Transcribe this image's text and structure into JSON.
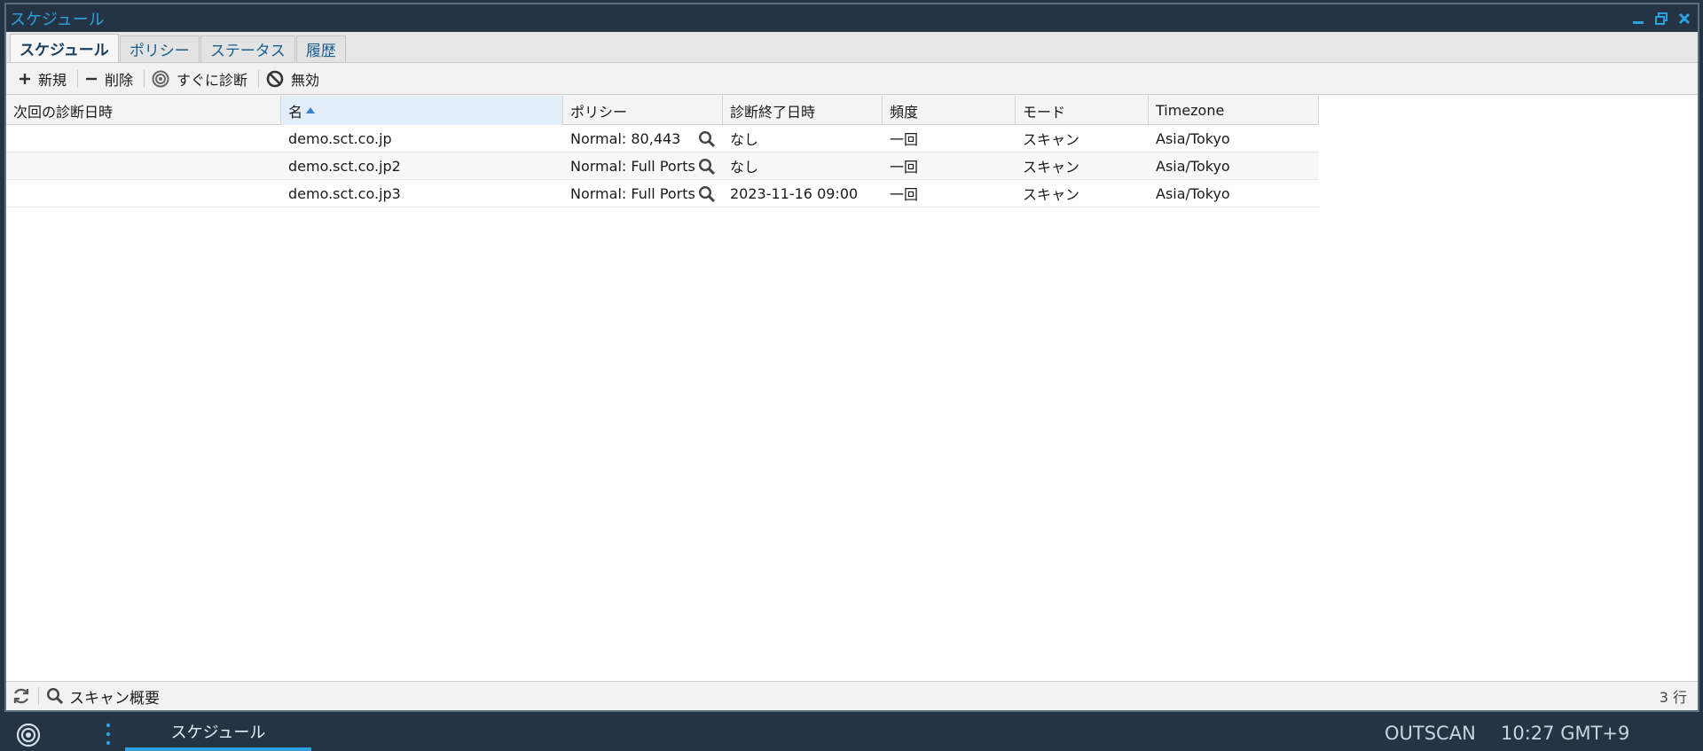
{
  "window": {
    "title": "スケジュール"
  },
  "tabs": [
    {
      "label": "スケジュール",
      "active": true
    },
    {
      "label": "ポリシー",
      "active": false
    },
    {
      "label": "ステータス",
      "active": false
    },
    {
      "label": "履歴",
      "active": false
    }
  ],
  "toolbar": {
    "new_label": "新規",
    "delete_label": "削除",
    "scan_now_label": "すぐに診断",
    "disable_label": "無効"
  },
  "table": {
    "columns": [
      "次回の診断日時",
      "名",
      "ポリシー",
      "診断終了日時",
      "頻度",
      "モード",
      "Timezone"
    ],
    "sorted_column": "名",
    "sort_direction": "ascending",
    "rows": [
      {
        "next_scan": "",
        "name": "demo.sct.co.jp",
        "policy": "Normal: 80,443",
        "end_date": "なし",
        "frequency": "一回",
        "mode": "スキャン",
        "timezone": "Asia/Tokyo"
      },
      {
        "next_scan": "",
        "name": "demo.sct.co.jp2",
        "policy": "Normal: Full Ports",
        "end_date": "なし",
        "frequency": "一回",
        "mode": "スキャン",
        "timezone": "Asia/Tokyo"
      },
      {
        "next_scan": "",
        "name": "demo.sct.co.jp3",
        "policy": "Normal: Full Ports",
        "end_date": "2023-11-16 09:00",
        "frequency": "一回",
        "mode": "スキャン",
        "timezone": "Asia/Tokyo"
      }
    ]
  },
  "statusbar": {
    "scan_summary_label": "スキャン概要",
    "row_count": "3 行"
  },
  "taskbar": {
    "task_label": "スケジュール",
    "brand": "OUTSCAN",
    "clock": "10:27 GMT+9"
  },
  "colors": {
    "accent": "#2ba1e0",
    "titlebar_bg": "#243444",
    "sorted_header_bg": "#e3eefb"
  },
  "icons": {
    "minimize": "minimize-icon",
    "restore": "restore-icon",
    "close": "close-icon",
    "new": "plus-icon",
    "delete": "minus-icon",
    "scan_now": "target-icon",
    "disable": "prohibited-icon",
    "policy_lookup": "magnifier-icon",
    "refresh": "refresh-icon",
    "scan_summary": "magnifier-icon",
    "app_logo": "target-logo-icon",
    "menu": "vertical-dots-icon"
  }
}
